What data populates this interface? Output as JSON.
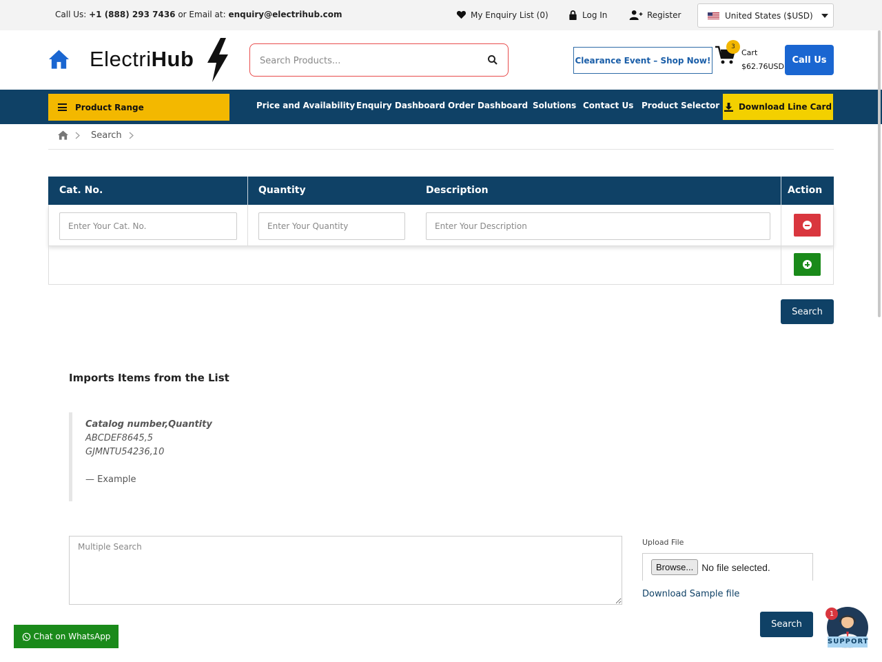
{
  "topbar": {
    "call_prefix": "Call Us: ",
    "phone": "+1 (888) 293 7436",
    "email_prefix": " or Email at: ",
    "email": "enquiry@electrihub.com",
    "enquiry_list": "My Enquiry List (0)",
    "login": "Log In",
    "register": "Register",
    "country": "United States ($USD)"
  },
  "header": {
    "logo_light": "Electri",
    "logo_bold": "Hub",
    "search_placeholder": "Search Products...",
    "clearance": "Clearance Event – Shop Now!",
    "cart_count": "3",
    "cart_label": "Cart",
    "cart_total": "$62.76USD",
    "call_us": "Call Us"
  },
  "nav": {
    "product_range": "Product Range",
    "items": [
      "Price and Availability",
      "Enquiry Dashboard",
      "Order Dashboard",
      "Solutions",
      "Contact Us",
      "Product Selector"
    ],
    "line_card": "Download Line Card"
  },
  "breadcrumb": {
    "current": "Search"
  },
  "table": {
    "headers": {
      "cat": "Cat. No.",
      "quantity": "Quantity",
      "description": "Description",
      "action": "Action"
    },
    "placeholders": {
      "cat": "Enter Your Cat. No.",
      "quantity": "Enter Your Quantity",
      "description": "Enter Your Description"
    },
    "search": "Search"
  },
  "import": {
    "title": "Imports Items from the List",
    "quote_lines": [
      "Catalog number,Quantity",
      "ABCDEF8645,5",
      "GJMNTU54236,10"
    ],
    "cite": "— Example",
    "multi_placeholder": "Multiple Search",
    "upload_label": "Upload File",
    "browse": "Browse...",
    "no_file": "No file selected.",
    "sample": "Download Sample file",
    "search": "Search"
  },
  "widgets": {
    "whatsapp": "Chat on WhatsApp",
    "support": "SUPPORT",
    "support_badge": "1"
  },
  "colors": {
    "navy": "#0f4166",
    "yellow": "#f3b800",
    "blue": "#1a66d1",
    "red": "#d9363e",
    "green": "#1a8a1a"
  }
}
